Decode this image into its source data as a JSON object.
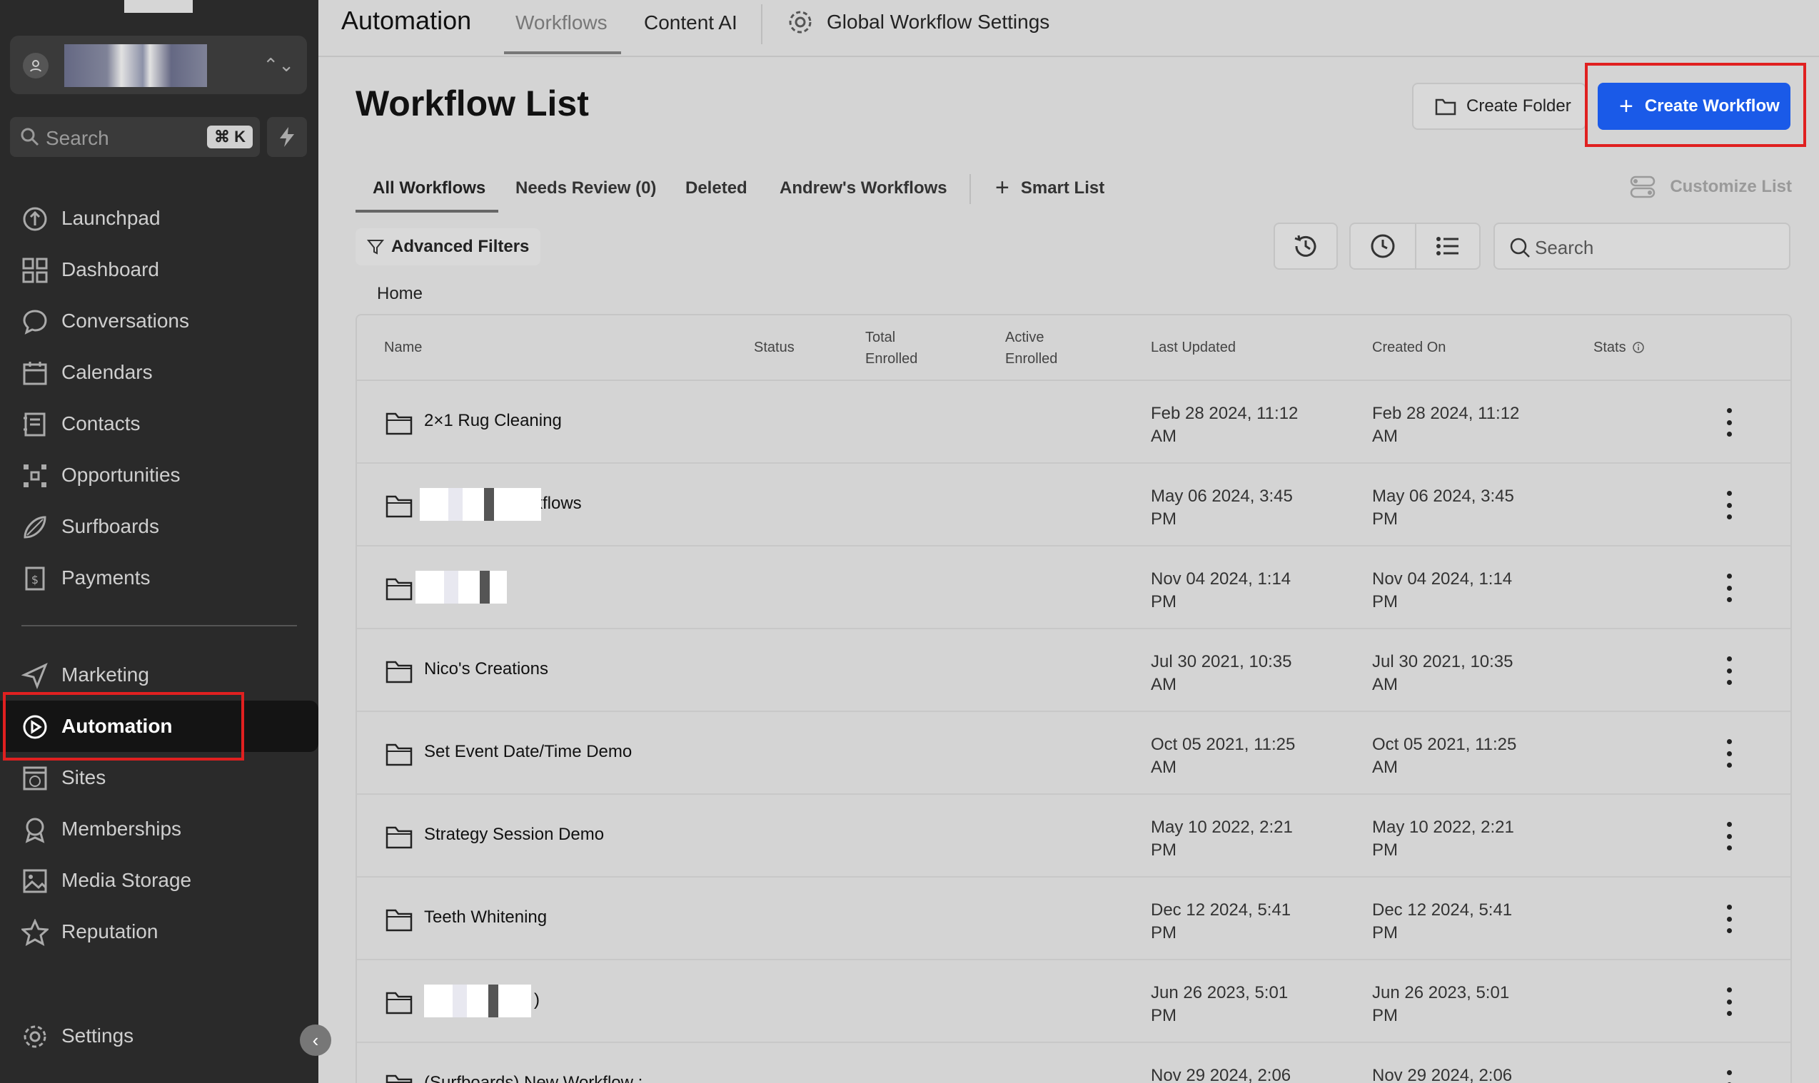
{
  "sidebar": {
    "search_placeholder": "Search",
    "search_shortcut": "⌘ K",
    "nav": [
      {
        "label": "Launchpad",
        "icon": "launchpad-icon"
      },
      {
        "label": "Dashboard",
        "icon": "dashboard-icon"
      },
      {
        "label": "Conversations",
        "icon": "chat-icon"
      },
      {
        "label": "Calendars",
        "icon": "calendar-icon"
      },
      {
        "label": "Contacts",
        "icon": "contacts-icon"
      },
      {
        "label": "Opportunities",
        "icon": "opportunities-icon"
      },
      {
        "label": "Surfboards",
        "icon": "surfboard-icon"
      },
      {
        "label": "Payments",
        "icon": "payments-icon"
      },
      {
        "label": "Marketing",
        "icon": "send-icon"
      },
      {
        "label": "Automation",
        "icon": "automation-icon",
        "active": true
      },
      {
        "label": "Sites",
        "icon": "sites-icon"
      },
      {
        "label": "Memberships",
        "icon": "membership-icon"
      },
      {
        "label": "Media Storage",
        "icon": "image-icon"
      },
      {
        "label": "Reputation",
        "icon": "star-icon"
      }
    ],
    "settings_label": "Settings"
  },
  "topbar": {
    "title": "Automation",
    "tabs": [
      "Workflows",
      "Content AI"
    ],
    "settings_label": "Global Workflow Settings"
  },
  "main": {
    "title": "Workflow List",
    "create_folder_label": "Create Folder",
    "create_workflow_label": "Create Workflow",
    "subtabs": [
      "All Workflows",
      "Needs Review (0)",
      "Deleted",
      "Andrew's Workflows"
    ],
    "smart_list_label": "Smart List",
    "customize_label": "Customize List",
    "advanced_filters_label": "Advanced Filters",
    "search_placeholder": "Search",
    "breadcrumb": "Home"
  },
  "table": {
    "headers": {
      "name": "Name",
      "status": "Status",
      "total_1": "Total",
      "total_2": "Enrolled",
      "active_1": "Active",
      "active_2": "Enrolled",
      "updated": "Last Updated",
      "created": "Created On",
      "stats": "Stats"
    },
    "rows": [
      {
        "name": "2×1 Rug Cleaning",
        "upd1": "Feb 28 2024, 11:12",
        "upd2": "AM",
        "cre1": "Feb 28 2024, 11:12",
        "cre2": "AM"
      },
      {
        "name": "rkflows",
        "upd1": "May 06 2024, 3:45",
        "upd2": "PM",
        "cre1": "May 06 2024, 3:45",
        "cre2": "PM"
      },
      {
        "name": "",
        "upd1": "Nov 04 2024, 1:14",
        "upd2": "PM",
        "cre1": "Nov 04 2024, 1:14",
        "cre2": "PM"
      },
      {
        "name": "Nico's Creations",
        "upd1": "Jul 30 2021, 10:35",
        "upd2": "AM",
        "cre1": "Jul 30 2021, 10:35",
        "cre2": "AM"
      },
      {
        "name": "Set Event Date/Time Demo",
        "upd1": "Oct 05 2021, 11:25",
        "upd2": "AM",
        "cre1": "Oct 05 2021, 11:25",
        "cre2": "AM"
      },
      {
        "name": "Strategy Session Demo",
        "upd1": "May 10 2022, 2:21",
        "upd2": "PM",
        "cre1": "May 10 2022, 2:21",
        "cre2": "PM"
      },
      {
        "name": "Teeth Whitening",
        "upd1": "Dec 12 2024, 5:41",
        "upd2": "PM",
        "cre1": "Dec 12 2024, 5:41",
        "cre2": "PM"
      },
      {
        "name": ")",
        "upd1": "Jun 26 2023, 5:01",
        "upd2": "PM",
        "cre1": "Jun 26 2023, 5:01",
        "cre2": "PM"
      },
      {
        "name": "(Surfboards) New Workflow :",
        "upd1": "Nov 29 2024, 2:06",
        "upd2": "",
        "cre1": "Nov 29 2024, 2:06",
        "cre2": ""
      }
    ]
  }
}
